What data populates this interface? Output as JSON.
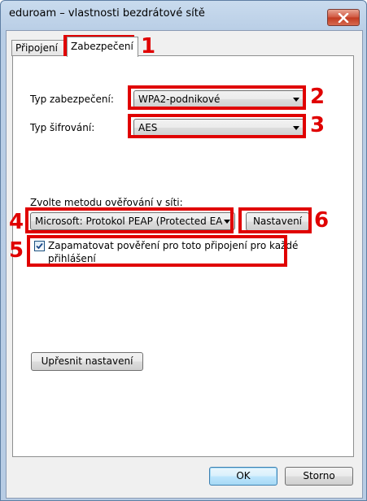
{
  "window": {
    "title": "eduroam – vlastnosti bezdrátové sítě",
    "close_icon": "close-icon"
  },
  "tabs": [
    {
      "label": "Připojení",
      "active": false
    },
    {
      "label": "Zabezpečení",
      "active": true
    }
  ],
  "security": {
    "type_label": "Typ zabezpečení:",
    "type_value": "WPA2-podnikové",
    "encryption_label": "Typ šifrování:",
    "encryption_value": "AES",
    "auth_method_label": "Zvolte metodu ověřování v síti:",
    "auth_method_value": "Microsoft: Protokol PEAP (Protected EA",
    "settings_button": "Nastavení",
    "remember_checkbox_checked": true,
    "remember_checkbox_label_line1": "Zapamatovat pověření pro toto připojení pro každé",
    "remember_checkbox_label_line2": "přihlášení",
    "advanced_button": "Upřesnit nastavení"
  },
  "footer": {
    "ok_button": "OK",
    "cancel_button": "Storno"
  },
  "annotations": [
    "1",
    "2",
    "3",
    "4",
    "5",
    "6"
  ],
  "colors": {
    "annotation_red": "#e00000",
    "window_frame": "#b8cde5",
    "close_button": "#c2391f"
  }
}
